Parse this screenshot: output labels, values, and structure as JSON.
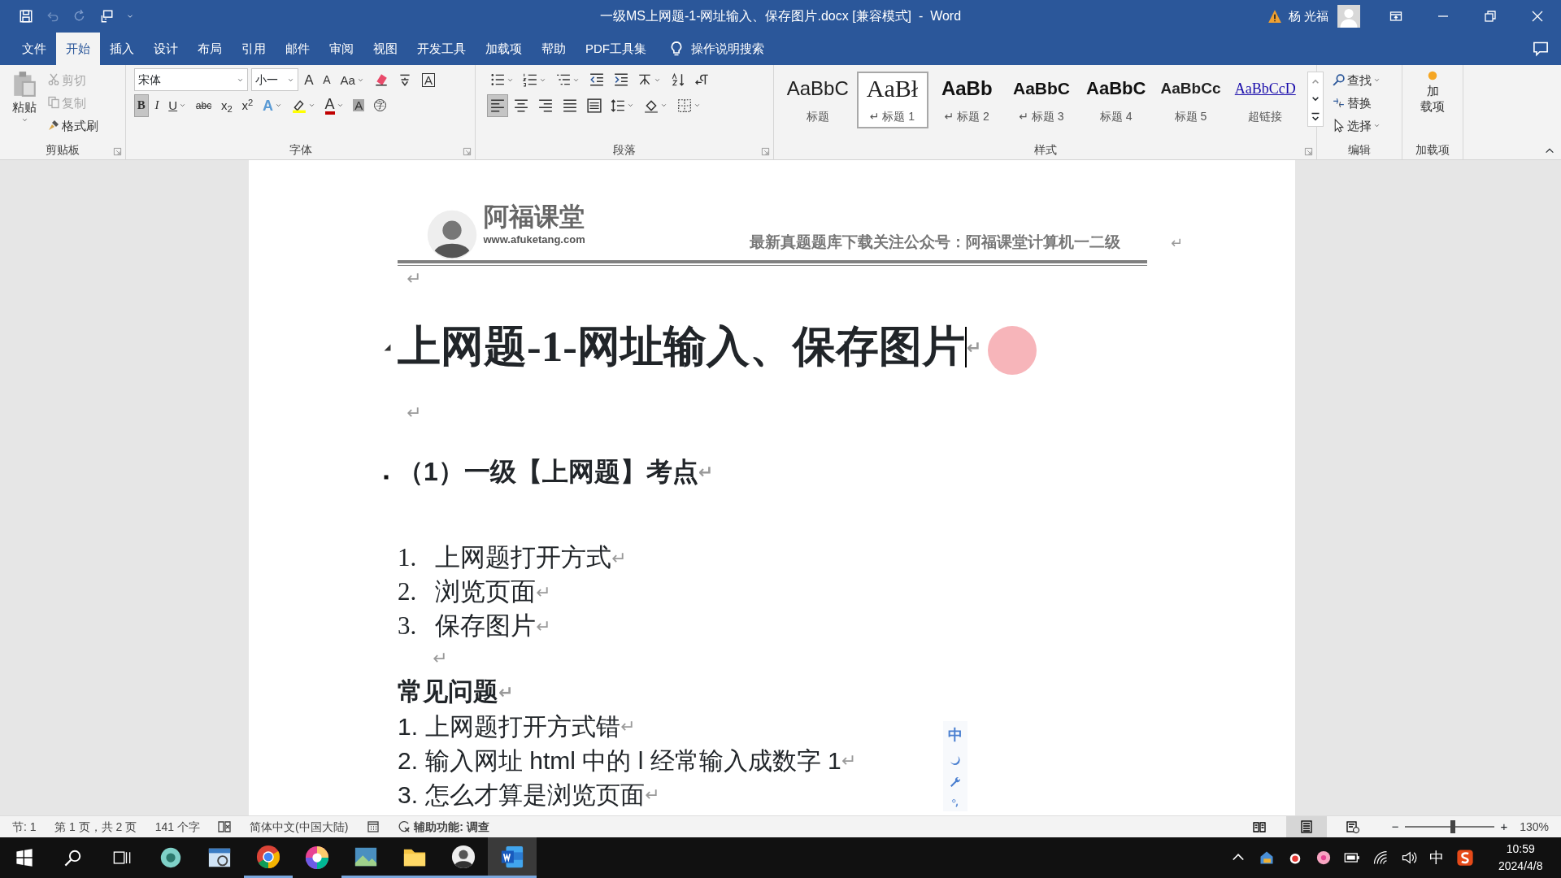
{
  "title_bar": {
    "title": "一级MS上网题-1-网址输入、保存图片.docx [兼容模式]  -  Word",
    "user": "杨 光福",
    "undo_disabled": true
  },
  "menu_tabs": [
    {
      "label": "文件",
      "selected": false
    },
    {
      "label": "开始",
      "selected": true
    },
    {
      "label": "插入",
      "selected": false
    },
    {
      "label": "设计",
      "selected": false
    },
    {
      "label": "布局",
      "selected": false
    },
    {
      "label": "引用",
      "selected": false
    },
    {
      "label": "邮件",
      "selected": false
    },
    {
      "label": "审阅",
      "selected": false
    },
    {
      "label": "视图",
      "selected": false
    },
    {
      "label": "开发工具",
      "selected": false
    },
    {
      "label": "加载项",
      "selected": false
    },
    {
      "label": "帮助",
      "selected": false
    },
    {
      "label": "PDF工具集",
      "selected": false
    }
  ],
  "tell_me": "操作说明搜索",
  "ribbon": {
    "clipboard": {
      "label": "剪贴板",
      "paste": "粘贴",
      "items": [
        {
          "kind": "cut",
          "label": "剪切",
          "disabled": true
        },
        {
          "kind": "copy",
          "label": "复制",
          "disabled": true
        },
        {
          "kind": "painter",
          "label": "格式刷",
          "disabled": false
        }
      ]
    },
    "font": {
      "label": "字体",
      "name": "宋体",
      "size": "小一",
      "row1": [
        {
          "kind": "grow",
          "label": "A"
        },
        {
          "kind": "shrink",
          "label": "A"
        },
        {
          "kind": "case",
          "label": "Aa"
        },
        {
          "kind": "clear"
        },
        {
          "kind": "phonetic"
        },
        {
          "kind": "border",
          "label": "A"
        }
      ],
      "row2": [
        {
          "kind": "bold",
          "label": "B",
          "on": true
        },
        {
          "kind": "italic",
          "label": "I",
          "on": false
        },
        {
          "kind": "underline",
          "label": "U",
          "on": false
        },
        {
          "kind": "strike",
          "label": "abc",
          "on": false
        },
        {
          "kind": "sub",
          "label": "x$_{2}$",
          "on": false
        },
        {
          "kind": "sup",
          "label": "x$^{2}$",
          "on": false
        },
        {
          "kind": "effect",
          "label": "A",
          "on": false
        },
        {
          "kind": "highlight",
          "on": false
        },
        {
          "kind": "fontcolor",
          "label": "A",
          "on": false
        },
        {
          "kind": "shading",
          "label": "A",
          "on": false
        },
        {
          "kind": "enclose",
          "label": "字",
          "on": false
        }
      ]
    },
    "paragraph": {
      "label": "段落",
      "row1": [
        {
          "kind": "bullets",
          "on": false
        },
        {
          "kind": "numbering",
          "on": false
        },
        {
          "kind": "multilevel",
          "on": false
        },
        {
          "kind": "outdent",
          "on": false
        },
        {
          "kind": "indent",
          "on": false
        },
        {
          "kind": "layout",
          "on": false
        },
        {
          "kind": "sort",
          "on": false
        },
        {
          "kind": "marks",
          "on": false
        }
      ],
      "row2": [
        {
          "kind": "left",
          "on": true
        },
        {
          "kind": "center",
          "on": false
        },
        {
          "kind": "right",
          "on": false
        },
        {
          "kind": "justify",
          "on": false
        },
        {
          "kind": "distribute",
          "on": false
        },
        {
          "kind": "spacing",
          "on": false
        },
        {
          "kind": "fill",
          "on": false
        },
        {
          "kind": "borders",
          "on": false
        }
      ]
    },
    "styles": {
      "label": "样式",
      "items": [
        {
          "kind": "title",
          "preview": "AaBbC",
          "label": "标题",
          "selected": false
        },
        {
          "kind": "h1",
          "preview": "AaBł",
          "label": "↵ 标题 1",
          "selected": true
        },
        {
          "kind": "h2",
          "preview": "AaBb",
          "label": "↵ 标题 2",
          "selected": false
        },
        {
          "kind": "h3",
          "preview": "AaBbC",
          "label": "↵ 标题 3",
          "selected": false
        },
        {
          "kind": "h4",
          "preview": "AaBbC",
          "label": "标题 4",
          "selected": false
        },
        {
          "kind": "h5",
          "preview": "AaBbCc",
          "label": "标题 5",
          "selected": false
        },
        {
          "kind": "link",
          "preview": "AaBbCcD",
          "label": "超链接",
          "selected": false
        }
      ]
    },
    "editing": {
      "label": "编辑",
      "items": [
        {
          "kind": "find",
          "label": "查找"
        },
        {
          "kind": "replace",
          "label": "替换"
        },
        {
          "kind": "select",
          "label": "选择"
        }
      ]
    },
    "addins": {
      "label": "加载项",
      "button": [
        "加",
        "载项"
      ]
    }
  },
  "document": {
    "header": {
      "brand": "阿福课堂",
      "url": "www.afuketang.com",
      "notice": "最新真题题库下载关注公众号：阿福课堂计算机一二级",
      "mark": "↵"
    },
    "paragraphs": [
      {
        "kind": "empty",
        "mark": "↵"
      },
      {
        "kind": "heading1",
        "text": "上网题-1-网址输入、保存图片",
        "mark": "↵",
        "cursor": true
      },
      {
        "kind": "empty",
        "mark": "↵"
      },
      {
        "kind": "heading2",
        "text": "（1）一级【上网题】考点",
        "mark": "↵"
      },
      {
        "kind": "numbered",
        "number": "1.",
        "text": "上网题打开方式",
        "mark": "↵"
      },
      {
        "kind": "numbered",
        "number": "2.",
        "text": "浏览页面",
        "mark": "↵"
      },
      {
        "kind": "numbered",
        "number": "3.",
        "text": "保存图片",
        "mark": "↵"
      },
      {
        "kind": "empty_indent",
        "mark": "↵"
      },
      {
        "kind": "bold",
        "text": "常见问题",
        "mark": "↵"
      },
      {
        "kind": "tight",
        "number": "1.",
        "text": "上网题打开方式错",
        "mark": "↵"
      },
      {
        "kind": "tight",
        "number": "2.",
        "text": "输入网址 html 中的 l 经常输入成数字 1",
        "mark": "↵"
      },
      {
        "kind": "tight",
        "number": "3.",
        "text": "怎么才算是浏览页面",
        "mark": "↵"
      }
    ]
  },
  "ime_toolbar": {
    "mode": "中"
  },
  "status_bar": {
    "items": [
      {
        "kind": "text",
        "label": "节: 1"
      },
      {
        "kind": "text",
        "label": "第 1 页，共 2 页"
      },
      {
        "kind": "text",
        "label": "141 个字"
      },
      {
        "kind": "proof"
      },
      {
        "kind": "text",
        "label": "简体中文(中国大陆)"
      },
      {
        "kind": "macro"
      },
      {
        "kind": "access",
        "label": "辅助功能: 调查"
      }
    ],
    "views": [
      {
        "kind": "read",
        "selected": false
      },
      {
        "kind": "print",
        "selected": true
      },
      {
        "kind": "web",
        "selected": false
      }
    ],
    "zoom": {
      "minus": "−",
      "plus": "+",
      "level": 0.54,
      "value": "130%"
    }
  },
  "taskbar": {
    "apps": [
      {
        "kind": "flower",
        "running": false,
        "active": false
      },
      {
        "kind": "viewer",
        "running": false,
        "active": false
      },
      {
        "kind": "chrome",
        "running": true,
        "active": false
      },
      {
        "kind": "wheel",
        "running": false,
        "active": false
      },
      {
        "kind": "photos",
        "running": true,
        "active": false
      },
      {
        "kind": "folder",
        "running": true,
        "active": false
      },
      {
        "kind": "person",
        "running": true,
        "active": false
      },
      {
        "kind": "word",
        "running": true,
        "active": true
      }
    ],
    "ime": "中",
    "time": "10:59",
    "date": "2024/4/8"
  }
}
